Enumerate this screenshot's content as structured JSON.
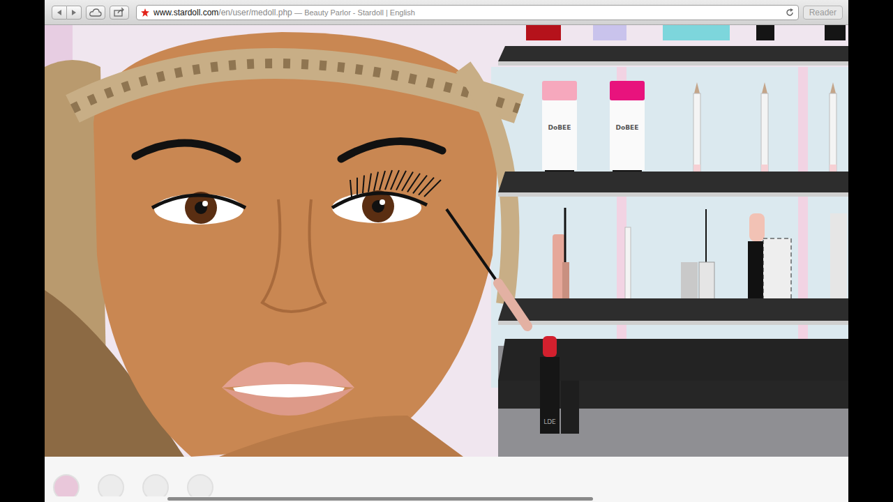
{
  "browser": {
    "url_host": "www.stardoll.com",
    "url_path": "/en/user/medoll.php",
    "page_title": "— Beauty Parlor - Stardoll | English",
    "reader": {
      "label": "Reader",
      "disabled": true
    }
  },
  "tubes": [
    {
      "label": "DoBEE",
      "color": "#f6a8bd"
    },
    {
      "label": "DoBEE",
      "color": "#e8137d"
    }
  ],
  "lipstick": {
    "label": "LDE",
    "color": "#d3202e"
  }
}
